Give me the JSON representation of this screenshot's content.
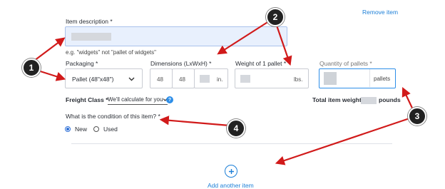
{
  "remove_item": "Remove item",
  "item_description": {
    "label": "Item description *",
    "hint": "e.g. \"widgets\" not \"pallet of widgets\""
  },
  "packaging": {
    "label": "Packaging *",
    "value": "Pallet (48\"x48\")"
  },
  "dimensions": {
    "label": "Dimensions (LxWxH) *",
    "length": "48",
    "width": "48",
    "unit": "in."
  },
  "weight": {
    "label": "Weight of 1 pallet *",
    "unit": "lbs."
  },
  "quantity": {
    "label": "Quantity of pallets *",
    "unit": "pallets"
  },
  "freight_class": {
    "label": "Freight Class *",
    "value": "We'll calculate for you"
  },
  "total_weight": {
    "label": "Total item weight:",
    "unit": "pounds"
  },
  "condition": {
    "question": "What is the condition of this item? *",
    "options": [
      "New",
      "Used"
    ],
    "selected": "New"
  },
  "add_item": "Add another item",
  "annotations": [
    "1",
    "2",
    "3",
    "4"
  ],
  "colors": {
    "accent": "#1c7fd7",
    "highlight": "#e8f0fd",
    "annotation_arrow": "#d11a1a"
  }
}
